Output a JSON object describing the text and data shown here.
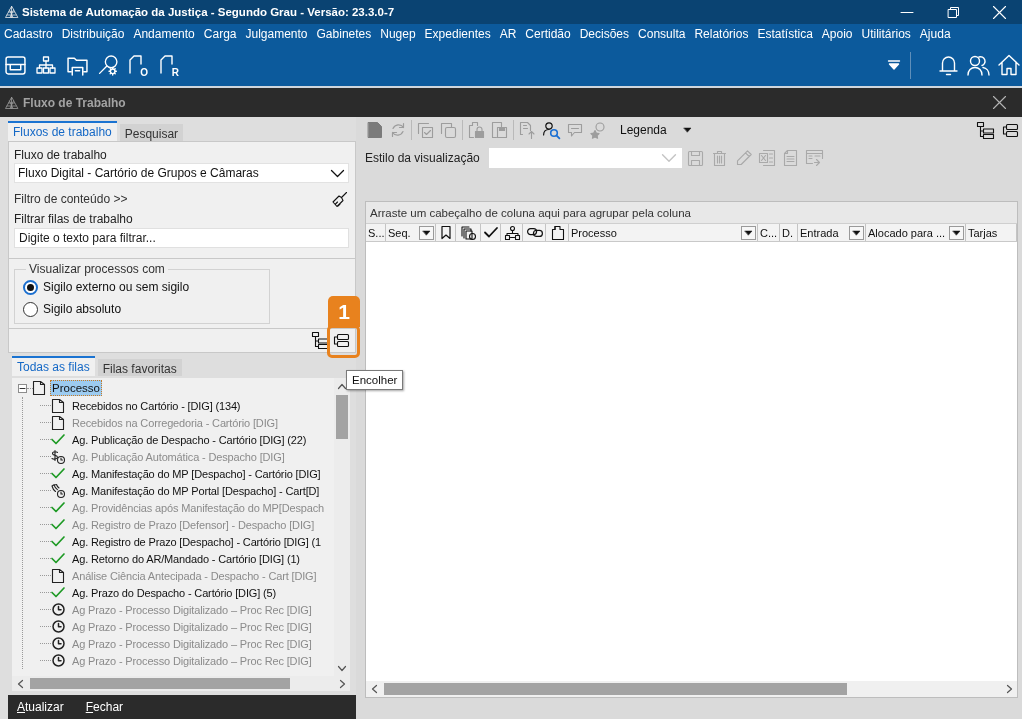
{
  "window": {
    "title": "Sistema de Automação da Justiça - Segundo Grau - Versão: 23.3.0-7"
  },
  "menu": [
    "Cadastro",
    "Distribuição",
    "Andamento",
    "Carga",
    "Julgamento",
    "Gabinetes",
    "Nugep",
    "Expedientes",
    "AR",
    "Certidão",
    "Decisões",
    "Consulta",
    "Relatórios",
    "Estatística",
    "Apoio",
    "Utilitários",
    "Ajuda"
  ],
  "toolbar": [
    {
      "kind": "tray"
    },
    {
      "kind": "hierarchy"
    },
    {
      "kind": "folder"
    },
    {
      "kind": "search-gear"
    },
    {
      "kind": "letter-doc",
      "letter": "O"
    },
    {
      "kind": "letter-doc",
      "letter": "R"
    }
  ],
  "child_window": {
    "title": "Fluxo de Trabalho"
  },
  "left_panel": {
    "tabs": [
      {
        "label": "Fluxos de trabalho",
        "selected": true
      },
      {
        "label": "Pesquisar",
        "selected": false
      }
    ],
    "workflow": {
      "label": "Fluxo de trabalho",
      "value": "Fluxo Digital - Cartório de Grupos e Câmaras"
    },
    "content_filter": {
      "label": "Filtro de conteúdo >>"
    },
    "queue_filter": {
      "label": "Filtrar filas de trabalho",
      "placeholder": "Digite o texto para filtrar..."
    },
    "visibility": {
      "legend": "Visualizar processos com",
      "options": [
        {
          "label": "Sigilo externo ou sem sigilo",
          "selected": true
        },
        {
          "label": "Sigilo absoluto",
          "selected": false
        }
      ]
    },
    "queue_tabs": [
      {
        "label": "Todas as filas",
        "selected": true
      },
      {
        "label": "Filas favoritas",
        "selected": false
      }
    ],
    "tree": {
      "label": "Processo",
      "expanded": true,
      "selected": true,
      "children": [
        {
          "label": "Recebidos no Cartório - [DIG] (134)",
          "kind": "page",
          "disabled": false,
          "selected": false
        },
        {
          "label": "Recebidos na Corregedoria - Cartório [DIG]",
          "kind": "page",
          "disabled": true,
          "selected": false
        },
        {
          "label": "Ag. Publicação de Despacho - Cartório [DIG] (22)",
          "kind": "check",
          "disabled": false,
          "selected": false
        },
        {
          "label": "Ag. Publicação Automática - Despacho [DIG]",
          "kind": "money-clock",
          "disabled": true,
          "selected": false
        },
        {
          "label": "Ag. Manifestação do MP [Despacho] - Cartório [DIG]",
          "kind": "check",
          "disabled": false,
          "selected": false
        },
        {
          "label": "Ag. Manifestação do MP Portal [Despacho] - Cart[D]",
          "kind": "hand-clock",
          "disabled": false,
          "selected": false
        },
        {
          "label": "Ag. Providências após Manifestação do MP[Despach",
          "kind": "check",
          "disabled": true,
          "selected": false
        },
        {
          "label": "Ag. Registro de Prazo [Defensor] - Despacho [DIG]",
          "kind": "check",
          "disabled": true,
          "selected": false
        },
        {
          "label": "Ag. Registro de Prazo [Despacho] - Cartório [DIG] (1",
          "kind": "check",
          "disabled": false,
          "selected": false
        },
        {
          "label": "Ag. Retorno do AR/Mandado - Cartório [DIG] (1)",
          "kind": "check",
          "disabled": false,
          "selected": false
        },
        {
          "label": "Análise Ciência Antecipada - Despacho - Cart [DIG]",
          "kind": "page",
          "disabled": true,
          "selected": false
        },
        {
          "label": "Ag. Prazo do Despacho - Cartório [DIG] (5)",
          "kind": "check",
          "disabled": false,
          "selected": false
        },
        {
          "label": "Ag Prazo - Processo Digitalizado – Proc Rec [DIG]",
          "kind": "clock",
          "disabled": true,
          "selected": false
        },
        {
          "label": "Ag Prazo - Processo Digitalizado – Proc Rec [DIG]",
          "kind": "clock",
          "disabled": true,
          "selected": false
        },
        {
          "label": "Ag Prazo - Processo Digitalizado – Proc Rec [DIG]",
          "kind": "clock",
          "disabled": true,
          "selected": false
        },
        {
          "label": "Ag Prazo - Processo Digitalizado – Proc Rec [DIG]",
          "kind": "clock",
          "disabled": true,
          "selected": false
        }
      ]
    },
    "buttons": [
      "Atualizar",
      "Fechar"
    ]
  },
  "callout": {
    "number": "1"
  },
  "tooltip": {
    "text": "Encolher"
  },
  "right_panel": {
    "legend_button": "Legenda",
    "view_style": {
      "label": "Estilo da visualização"
    },
    "group_hint": "Arraste um cabeçalho de coluna aqui para agrupar pela coluna",
    "columns": [
      {
        "kind": "text",
        "label": "S...",
        "filter": false
      },
      {
        "kind": "text",
        "label": "Seq.",
        "filter": true
      },
      {
        "kind": "bookmark"
      },
      {
        "kind": "copies"
      },
      {
        "kind": "check"
      },
      {
        "kind": "flow"
      },
      {
        "kind": "link"
      },
      {
        "kind": "document"
      },
      {
        "kind": "text",
        "label": "Processo",
        "filter": true
      },
      {
        "kind": "text",
        "label": "C...",
        "filter": false
      },
      {
        "kind": "text",
        "label": "D.",
        "filter": false
      },
      {
        "kind": "text",
        "label": "Entrada",
        "filter": true
      },
      {
        "kind": "text",
        "label": "Alocado para ...",
        "filter": true
      },
      {
        "kind": "text",
        "label": "Tarjas",
        "filter": false
      }
    ]
  }
}
